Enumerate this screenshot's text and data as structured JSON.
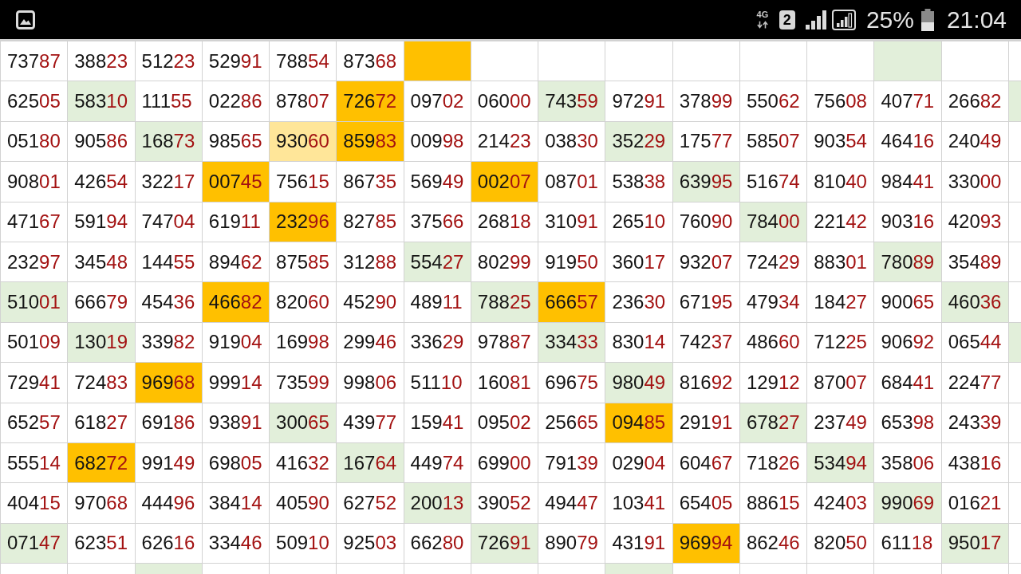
{
  "status_bar": {
    "network_type": "4G",
    "sim_slot": "2",
    "battery": "25%",
    "time": "21:04"
  },
  "sheet": {
    "rows": [
      {
        "cells": [
          {
            "lead": "737",
            "end": "87"
          },
          {
            "lead": "388",
            "end": "23"
          },
          {
            "lead": "512",
            "end": "23"
          },
          {
            "lead": "529",
            "end": "91"
          },
          {
            "lead": "788",
            "end": "54"
          },
          {
            "lead": "873",
            "end": "68"
          },
          {
            "color": "#ffc000"
          },
          {},
          {},
          {},
          {},
          {},
          {},
          {
            "color": "#e2efda"
          },
          {},
          {}
        ]
      },
      {
        "cells": [
          {
            "lead": "625",
            "end": "05"
          },
          {
            "lead": "583",
            "end": "10",
            "color": "#e2efda"
          },
          {
            "lead": "111",
            "end": "55"
          },
          {
            "lead": "022",
            "end": "86"
          },
          {
            "lead": "878",
            "end": "07"
          },
          {
            "lead": "726",
            "end": "72",
            "color": "#ffc000"
          },
          {
            "lead": "097",
            "end": "02"
          },
          {
            "lead": "060",
            "end": "00"
          },
          {
            "lead": "743",
            "end": "59",
            "color": "#e2efda"
          },
          {
            "lead": "972",
            "end": "91"
          },
          {
            "lead": "378",
            "end": "99"
          },
          {
            "lead": "550",
            "end": "62"
          },
          {
            "lead": "756",
            "end": "08"
          },
          {
            "lead": "407",
            "end": "71"
          },
          {
            "lead": "266",
            "end": "82"
          },
          {
            "color": "#e2efda"
          }
        ]
      },
      {
        "cells": [
          {
            "lead": "051",
            "end": "80"
          },
          {
            "lead": "905",
            "end": "86"
          },
          {
            "lead": "168",
            "end": "73",
            "color": "#e2efda"
          },
          {
            "lead": "985",
            "end": "65"
          },
          {
            "lead": "930",
            "end": "60",
            "color": "#ffe699"
          },
          {
            "lead": "859",
            "end": "83",
            "color": "#ffc000"
          },
          {
            "lead": "009",
            "end": "98"
          },
          {
            "lead": "214",
            "end": "23"
          },
          {
            "lead": "038",
            "end": "30"
          },
          {
            "lead": "352",
            "end": "29",
            "color": "#e2efda"
          },
          {
            "lead": "175",
            "end": "77"
          },
          {
            "lead": "585",
            "end": "07"
          },
          {
            "lead": "903",
            "end": "54"
          },
          {
            "lead": "464",
            "end": "16"
          },
          {
            "lead": "240",
            "end": "49"
          },
          {}
        ]
      },
      {
        "cells": [
          {
            "lead": "908",
            "end": "01"
          },
          {
            "lead": "426",
            "end": "54"
          },
          {
            "lead": "322",
            "end": "17"
          },
          {
            "lead": "007",
            "end": "45",
            "color": "#ffc000"
          },
          {
            "lead": "756",
            "end": "15"
          },
          {
            "lead": "867",
            "end": "35"
          },
          {
            "lead": "569",
            "end": "49"
          },
          {
            "lead": "002",
            "end": "07",
            "color": "#ffc000"
          },
          {
            "lead": "087",
            "end": "01"
          },
          {
            "lead": "538",
            "end": "38"
          },
          {
            "lead": "639",
            "end": "95",
            "color": "#e2efda"
          },
          {
            "lead": "516",
            "end": "74"
          },
          {
            "lead": "810",
            "end": "40"
          },
          {
            "lead": "984",
            "end": "41"
          },
          {
            "lead": "330",
            "end": "00"
          },
          {}
        ]
      },
      {
        "cells": [
          {
            "lead": "471",
            "end": "67"
          },
          {
            "lead": "591",
            "end": "94"
          },
          {
            "lead": "747",
            "end": "04"
          },
          {
            "lead": "619",
            "end": "11"
          },
          {
            "lead": "232",
            "end": "96",
            "color": "#ffc000"
          },
          {
            "lead": "827",
            "end": "85"
          },
          {
            "lead": "375",
            "end": "66"
          },
          {
            "lead": "268",
            "end": "18"
          },
          {
            "lead": "310",
            "end": "91"
          },
          {
            "lead": "265",
            "end": "10"
          },
          {
            "lead": "760",
            "end": "90"
          },
          {
            "lead": "784",
            "end": "00",
            "color": "#e2efda"
          },
          {
            "lead": "221",
            "end": "42"
          },
          {
            "lead": "903",
            "end": "16"
          },
          {
            "lead": "420",
            "end": "93"
          },
          {}
        ]
      },
      {
        "cells": [
          {
            "lead": "232",
            "end": "97"
          },
          {
            "lead": "345",
            "end": "48"
          },
          {
            "lead": "144",
            "end": "55"
          },
          {
            "lead": "894",
            "end": "62"
          },
          {
            "lead": "875",
            "end": "85"
          },
          {
            "lead": "312",
            "end": "88"
          },
          {
            "lead": "554",
            "end": "27",
            "color": "#e2efda"
          },
          {
            "lead": "802",
            "end": "99"
          },
          {
            "lead": "919",
            "end": "50"
          },
          {
            "lead": "360",
            "end": "17"
          },
          {
            "lead": "932",
            "end": "07"
          },
          {
            "lead": "724",
            "end": "29"
          },
          {
            "lead": "883",
            "end": "01"
          },
          {
            "lead": "780",
            "end": "89",
            "color": "#e2efda"
          },
          {
            "lead": "354",
            "end": "89"
          },
          {}
        ]
      },
      {
        "cells": [
          {
            "lead": "510",
            "end": "01",
            "color": "#e2efda"
          },
          {
            "lead": "666",
            "end": "79"
          },
          {
            "lead": "454",
            "end": "36"
          },
          {
            "lead": "466",
            "end": "82",
            "color": "#ffc000"
          },
          {
            "lead": "820",
            "end": "60"
          },
          {
            "lead": "452",
            "end": "90"
          },
          {
            "lead": "489",
            "end": "11"
          },
          {
            "lead": "788",
            "end": "25",
            "color": "#e2efda"
          },
          {
            "lead": "666",
            "end": "57",
            "color": "#ffc000"
          },
          {
            "lead": "236",
            "end": "30"
          },
          {
            "lead": "671",
            "end": "95"
          },
          {
            "lead": "479",
            "end": "34"
          },
          {
            "lead": "184",
            "end": "27"
          },
          {
            "lead": "900",
            "end": "65"
          },
          {
            "lead": "460",
            "end": "36",
            "color": "#e2efda"
          },
          {}
        ]
      },
      {
        "cells": [
          {
            "lead": "501",
            "end": "09"
          },
          {
            "lead": "130",
            "end": "19",
            "color": "#e2efda"
          },
          {
            "lead": "339",
            "end": "82"
          },
          {
            "lead": "919",
            "end": "04"
          },
          {
            "lead": "169",
            "end": "98"
          },
          {
            "lead": "299",
            "end": "46"
          },
          {
            "lead": "336",
            "end": "29"
          },
          {
            "lead": "978",
            "end": "87"
          },
          {
            "lead": "334",
            "end": "33",
            "color": "#e2efda"
          },
          {
            "lead": "830",
            "end": "14"
          },
          {
            "lead": "742",
            "end": "37"
          },
          {
            "lead": "486",
            "end": "60"
          },
          {
            "lead": "712",
            "end": "25"
          },
          {
            "lead": "906",
            "end": "92"
          },
          {
            "lead": "065",
            "end": "44"
          },
          {
            "color": "#e2efda"
          }
        ]
      },
      {
        "cells": [
          {
            "lead": "729",
            "end": "41"
          },
          {
            "lead": "724",
            "end": "83"
          },
          {
            "lead": "969",
            "end": "68",
            "color": "#ffc000"
          },
          {
            "lead": "999",
            "end": "14"
          },
          {
            "lead": "735",
            "end": "99"
          },
          {
            "lead": "998",
            "end": "06"
          },
          {
            "lead": "511",
            "end": "10"
          },
          {
            "lead": "160",
            "end": "81"
          },
          {
            "lead": "696",
            "end": "75"
          },
          {
            "lead": "980",
            "end": "49",
            "color": "#e2efda"
          },
          {
            "lead": "816",
            "end": "92"
          },
          {
            "lead": "129",
            "end": "12"
          },
          {
            "lead": "870",
            "end": "07"
          },
          {
            "lead": "684",
            "end": "41"
          },
          {
            "lead": "224",
            "end": "77"
          },
          {}
        ]
      },
      {
        "cells": [
          {
            "lead": "652",
            "end": "57"
          },
          {
            "lead": "618",
            "end": "27"
          },
          {
            "lead": "691",
            "end": "86"
          },
          {
            "lead": "938",
            "end": "91"
          },
          {
            "lead": "300",
            "end": "65",
            "color": "#e2efda"
          },
          {
            "lead": "439",
            "end": "77"
          },
          {
            "lead": "159",
            "end": "41"
          },
          {
            "lead": "095",
            "end": "02"
          },
          {
            "lead": "256",
            "end": "65"
          },
          {
            "lead": "094",
            "end": "85",
            "color": "#ffc000"
          },
          {
            "lead": "291",
            "end": "91"
          },
          {
            "lead": "678",
            "end": "27",
            "color": "#e2efda"
          },
          {
            "lead": "237",
            "end": "49"
          },
          {
            "lead": "653",
            "end": "98"
          },
          {
            "lead": "243",
            "end": "39"
          },
          {}
        ]
      },
      {
        "cells": [
          {
            "lead": "555",
            "end": "14"
          },
          {
            "lead": "682",
            "end": "72",
            "color": "#ffc000"
          },
          {
            "lead": "991",
            "end": "49"
          },
          {
            "lead": "698",
            "end": "05"
          },
          {
            "lead": "416",
            "end": "32"
          },
          {
            "lead": "167",
            "end": "64",
            "color": "#e2efda"
          },
          {
            "lead": "449",
            "end": "74"
          },
          {
            "lead": "699",
            "end": "00"
          },
          {
            "lead": "791",
            "end": "39"
          },
          {
            "lead": "029",
            "end": "04"
          },
          {
            "lead": "604",
            "end": "67"
          },
          {
            "lead": "718",
            "end": "26"
          },
          {
            "lead": "534",
            "end": "94",
            "color": "#e2efda"
          },
          {
            "lead": "358",
            "end": "06"
          },
          {
            "lead": "438",
            "end": "16"
          },
          {}
        ]
      },
      {
        "cells": [
          {
            "lead": "404",
            "end": "15"
          },
          {
            "lead": "970",
            "end": "68"
          },
          {
            "lead": "444",
            "end": "96"
          },
          {
            "lead": "384",
            "end": "14"
          },
          {
            "lead": "405",
            "end": "90"
          },
          {
            "lead": "627",
            "end": "52"
          },
          {
            "lead": "200",
            "end": "13",
            "color": "#e2efda"
          },
          {
            "lead": "390",
            "end": "52"
          },
          {
            "lead": "494",
            "end": "47"
          },
          {
            "lead": "103",
            "end": "41"
          },
          {
            "lead": "654",
            "end": "05"
          },
          {
            "lead": "886",
            "end": "15"
          },
          {
            "lead": "424",
            "end": "03"
          },
          {
            "lead": "990",
            "end": "69",
            "color": "#e2efda"
          },
          {
            "lead": "016",
            "end": "21"
          },
          {}
        ]
      },
      {
        "cells": [
          {
            "lead": "071",
            "end": "47",
            "color": "#e2efda"
          },
          {
            "lead": "623",
            "end": "51"
          },
          {
            "lead": "626",
            "end": "16"
          },
          {
            "lead": "334",
            "end": "46"
          },
          {
            "lead": "509",
            "end": "10"
          },
          {
            "lead": "925",
            "end": "03"
          },
          {
            "lead": "662",
            "end": "80"
          },
          {
            "lead": "726",
            "end": "91",
            "color": "#e2efda"
          },
          {
            "lead": "890",
            "end": "79"
          },
          {
            "lead": "431",
            "end": "91"
          },
          {
            "lead": "969",
            "end": "94",
            "color": "#ffc000"
          },
          {
            "lead": "862",
            "end": "46"
          },
          {
            "lead": "820",
            "end": "50"
          },
          {
            "lead": "611",
            "end": "18"
          },
          {
            "lead": "950",
            "end": "17",
            "color": "#e2efda"
          },
          {}
        ]
      },
      {
        "cells": [
          {},
          {},
          {
            "color": "#e2efda"
          },
          {},
          {},
          {},
          {},
          {},
          {},
          {
            "color": "#e2efda"
          },
          {},
          {},
          {},
          {},
          {},
          {}
        ]
      }
    ]
  }
}
